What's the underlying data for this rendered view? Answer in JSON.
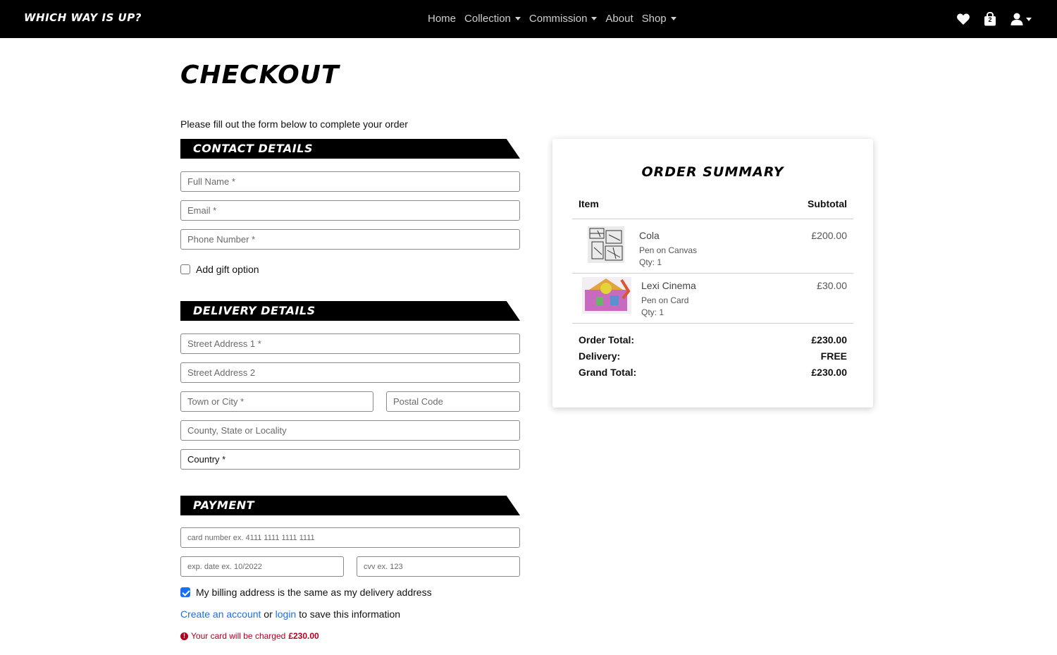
{
  "navbar": {
    "brand": "Which Way Is Up?",
    "links": [
      {
        "label": "Home",
        "dropdown": false
      },
      {
        "label": "Collection",
        "dropdown": true
      },
      {
        "label": "Commission",
        "dropdown": true
      },
      {
        "label": "About",
        "dropdown": false
      },
      {
        "label": "Shop",
        "dropdown": true
      }
    ],
    "icons": [
      "heart-icon",
      "shopping-bag-icon",
      "user-icon"
    ],
    "bag_count": "2"
  },
  "page": {
    "title": "Checkout",
    "intro": "Please fill out the form below to complete your order"
  },
  "contact": {
    "heading": "Contact Details",
    "full_name_placeholder": "Full Name *",
    "email_placeholder": "Email *",
    "phone_placeholder": "Phone Number *",
    "gift_label": "Add gift option",
    "gift_checked": false
  },
  "delivery": {
    "heading": "Delivery Details",
    "street1_placeholder": "Street Address 1 *",
    "street2_placeholder": "Street Address 2",
    "town_placeholder": "Town or City *",
    "postcode_placeholder": "Postal Code",
    "county_placeholder": "County, State or Locality",
    "country_value": "Country *"
  },
  "payment": {
    "heading": "Payment",
    "card_placeholder": "card number ex. 4111 1111 1111 1111",
    "exp_placeholder": "exp. date ex. 10/2022",
    "cvv_placeholder": "cvv ex. 123",
    "billing_label": "My billing address is the same as my delivery address",
    "billing_checked": true,
    "save_prefix": "",
    "create_account": "Create an account",
    "or": "or",
    "login": "login",
    "save_suffix": "to save this information",
    "charge_text": "Your card will be charged",
    "charge_amount": "£230.00"
  },
  "summary": {
    "title": "Order Summary",
    "col_item": "Item",
    "col_subtotal": "Subtotal",
    "items": [
      {
        "name": "Cola",
        "medium": "Pen on Canvas",
        "qty": "Qty: 1",
        "price": "£200.00"
      },
      {
        "name": "Lexi Cinema",
        "medium": "Pen on Card",
        "qty": "Qty: 1",
        "price": "£30.00"
      }
    ],
    "order_total_label": "Order Total:",
    "order_total": "£230.00",
    "delivery_label": "Delivery:",
    "delivery": "FREE",
    "grand_total_label": "Grand Total:",
    "grand_total": "£230.00"
  },
  "colors": {
    "navbar_bg": "#000000",
    "link": "#1a6ff5",
    "alert": "#b00020",
    "checkbox_checked": "#1a6ff5"
  }
}
